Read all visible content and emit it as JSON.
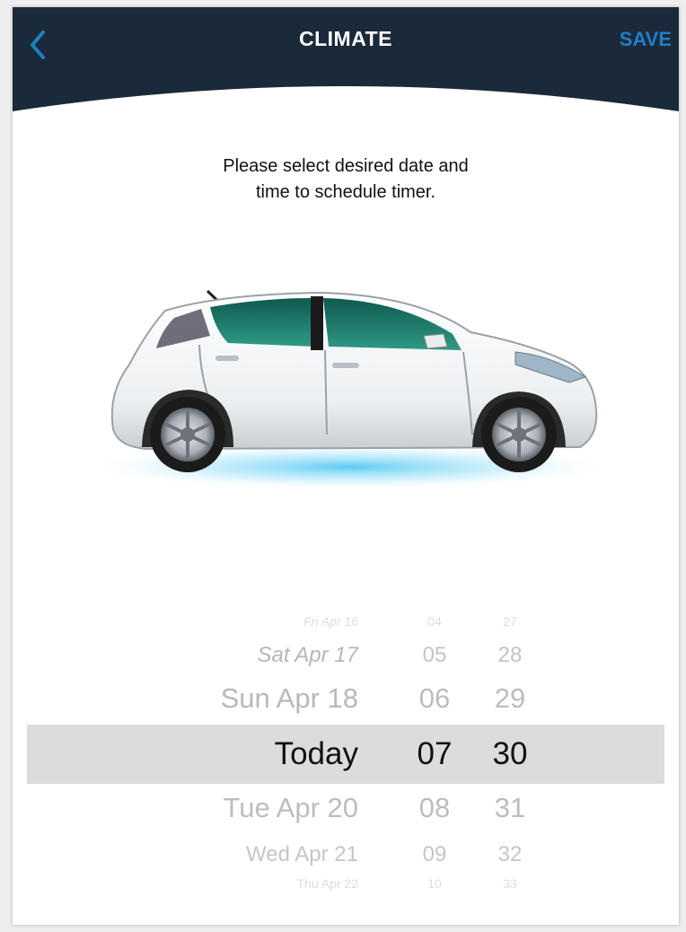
{
  "header": {
    "title": "CLIMATE",
    "save_label": "SAVE",
    "bg_color": "#1b2a3a",
    "accent_color": "#1d7fc6",
    "back_icon": "chevron-left-icon"
  },
  "instruction": "Please select desired date and\ntime to schedule timer.",
  "car_image": "white-hatchback-car-side-view",
  "picker": {
    "rows": [
      {
        "date": "Fri Apr 16",
        "hour": "04",
        "minute": "27"
      },
      {
        "date": "Sat Apr 17",
        "hour": "05",
        "minute": "28"
      },
      {
        "date": "Sun Apr 18",
        "hour": "06",
        "minute": "29"
      },
      {
        "date": "Today",
        "hour": "07",
        "minute": "30"
      },
      {
        "date": "Tue Apr 20",
        "hour": "08",
        "minute": "31"
      },
      {
        "date": "Wed Apr 21",
        "hour": "09",
        "minute": "32"
      },
      {
        "date": "Thu Apr 22",
        "hour": "10",
        "minute": "33"
      }
    ],
    "selected_index": 3
  }
}
